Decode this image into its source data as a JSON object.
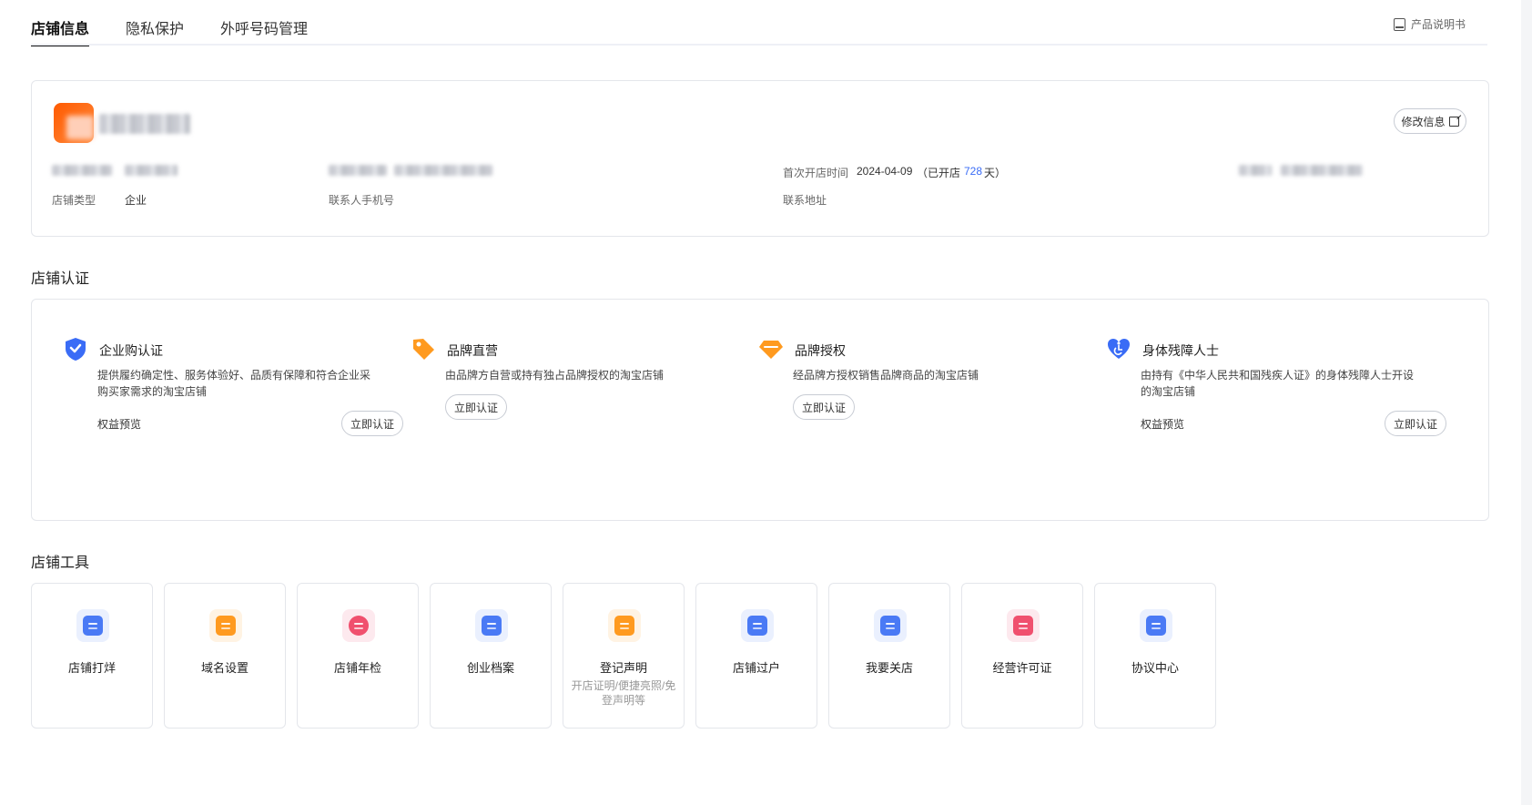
{
  "tabs": [
    {
      "label": "店铺信息",
      "active": true
    },
    {
      "label": "隐私保护",
      "active": false
    },
    {
      "label": "外呼号码管理",
      "active": false
    }
  ],
  "manual_link": {
    "label": "产品说明书",
    "icon": "book-icon"
  },
  "shop_info": {
    "edit_button": "修改信息",
    "open_time_label": "首次开店时间",
    "open_date": "2024-04-09",
    "open_days_prefix": "（已开店",
    "open_days": "728",
    "open_days_suffix": "天）",
    "shop_type_label": "店铺类型",
    "shop_type_value": "企业",
    "contact_phone_label": "联系人手机号",
    "address_label": "联系地址"
  },
  "cert_section": {
    "title": "店铺认证",
    "items": [
      {
        "title": "企业购认证",
        "desc": "提供履约确定性、服务体验好、品质有保障和符合企业采购买家需求的淘宝店铺",
        "benefit": "权益预览",
        "button": "立即认证",
        "icon": "shield-check-icon",
        "color": "#3a6cf6"
      },
      {
        "title": "品牌直营",
        "desc": "由品牌方自营或持有独占品牌授权的淘宝店铺",
        "benefit": "",
        "button": "立即认证",
        "icon": "tag-icon",
        "color": "#ff9a1f"
      },
      {
        "title": "品牌授权",
        "desc": "经品牌方授权销售品牌商品的淘宝店铺",
        "benefit": "",
        "button": "立即认证",
        "icon": "diamond-icon",
        "color": "#ff9a1f"
      },
      {
        "title": "身体残障人士",
        "desc": "由持有《中华人民共和国残疾人证》的身体残障人士开设的淘宝店铺",
        "benefit": "权益预览",
        "button": "立即认证",
        "icon": "heart-accessibility-icon",
        "color": "#3a6cf6"
      }
    ]
  },
  "tools_section": {
    "title": "店铺工具",
    "items": [
      {
        "label": "店铺打烊",
        "sub": "",
        "icon": "shop-close-icon",
        "color": "#4a7af5",
        "bg": "#eaf0fe"
      },
      {
        "label": "域名设置",
        "sub": "",
        "icon": "domain-icon",
        "color": "#ff9a1f",
        "bg": "#fff3e3"
      },
      {
        "label": "店铺年检",
        "sub": "",
        "icon": "inspection-shield-icon",
        "color": "#f0506e",
        "bg": "#fde9ee"
      },
      {
        "label": "创业档案",
        "sub": "",
        "icon": "archive-icon",
        "color": "#4a7af5",
        "bg": "#eaf0fe"
      },
      {
        "label": "登记声明",
        "sub": "开店证明/便捷亮照/免登声明等",
        "icon": "declaration-icon",
        "color": "#ff9a1f",
        "bg": "#fff3e3"
      },
      {
        "label": "店铺过户",
        "sub": "",
        "icon": "transfer-icon",
        "color": "#4a7af5",
        "bg": "#eaf0fe"
      },
      {
        "label": "我要关店",
        "sub": "",
        "icon": "close-shop-icon",
        "color": "#4a7af5",
        "bg": "#eaf0fe"
      },
      {
        "label": "经营许可证",
        "sub": "",
        "icon": "license-folder-icon",
        "color": "#f0506e",
        "bg": "#fde9ee"
      },
      {
        "label": "协议中心",
        "sub": "",
        "icon": "agreement-icon",
        "color": "#4a7af5",
        "bg": "#eaf0fe"
      }
    ]
  }
}
